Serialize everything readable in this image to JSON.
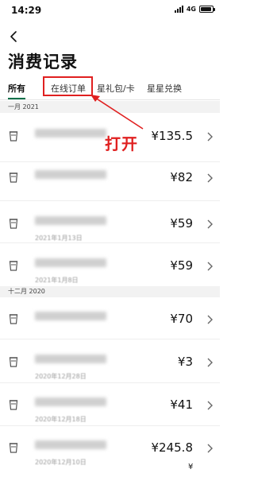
{
  "status": {
    "time": "14:29",
    "network": "4G",
    "battery_level": 0.9
  },
  "header": {
    "title": "消费记录"
  },
  "tabs": [
    {
      "label": "所有",
      "active": true
    },
    {
      "label": "在线订单",
      "active": false
    },
    {
      "label": "星礼包/卡",
      "active": false
    },
    {
      "label": "星星兑换",
      "active": false
    }
  ],
  "annotation": {
    "text": "打开",
    "color": "#e02020"
  },
  "sections": [
    {
      "label": "一月 2021",
      "items": [
        {
          "date": "",
          "amount": "¥135.5"
        },
        {
          "date": "",
          "amount": "¥82"
        },
        {
          "date": "2021年1月13日",
          "amount": "¥59"
        },
        {
          "date": "2021年1月8日",
          "amount": "¥59"
        }
      ]
    },
    {
      "label": "十二月 2020",
      "items": [
        {
          "date": "",
          "amount": "¥70"
        },
        {
          "date": "2020年12月28日",
          "amount": "¥3"
        },
        {
          "date": "2020年12月18日",
          "amount": "¥41"
        },
        {
          "date": "2020年12月10日",
          "amount": "¥245.8"
        }
      ]
    }
  ],
  "footer": {
    "partial_amount": "¥"
  },
  "colors": {
    "accent": "#00704a",
    "highlight": "#e02020",
    "section_bg": "#f2f2f2"
  }
}
